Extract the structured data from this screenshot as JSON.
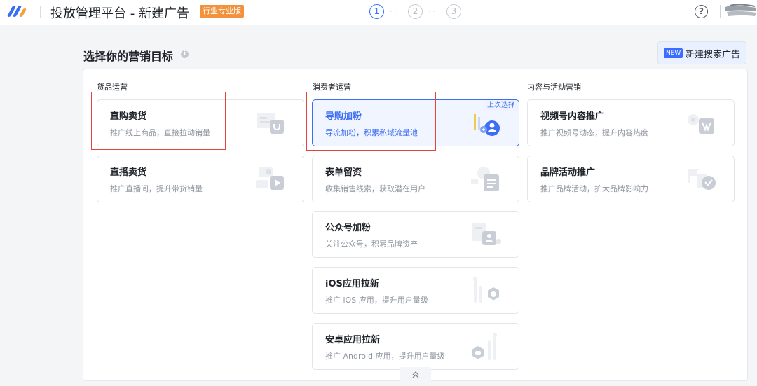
{
  "header": {
    "title": "投放管理平台 - 新建广告",
    "edition_badge": "行业专业版",
    "steps": [
      "1",
      "2",
      "3"
    ],
    "step_separator": "··",
    "help_symbol": "?",
    "logo_colors": [
      "#3b6ef6",
      "#f2a33a"
    ]
  },
  "section": {
    "heading": "选择你的营销目标",
    "info_symbol": "i",
    "search_ad": {
      "badge": "NEW",
      "label": "新建搜索广告"
    }
  },
  "columns": [
    {
      "title": "货品运营",
      "cards": [
        {
          "title": "直购卖货",
          "desc": "推广线上商品，直接拉动销量",
          "icon": "shopping-bag-icon"
        },
        {
          "title": "直播卖货",
          "desc": "推广直播间，提升带货销量",
          "icon": "live-play-icon"
        }
      ]
    },
    {
      "title": "消费者运营",
      "cards": [
        {
          "title": "导购加粉",
          "desc": "导流加粉，积累私域流量池",
          "icon": "add-fans-icon",
          "selected": true,
          "badge": "上次选择"
        },
        {
          "title": "表单留资",
          "desc": "收集销售线索，获取潜在用户",
          "icon": "form-icon"
        },
        {
          "title": "公众号加粉",
          "desc": "关注公众号，积累品牌资产",
          "icon": "official-account-icon"
        },
        {
          "title": "iOS应用拉新",
          "desc": "推广 iOS 应用，提升用户量级",
          "icon": "ios-app-icon"
        },
        {
          "title": "安卓应用拉新",
          "desc": "推广 Android 应用，提升用户量级",
          "icon": "android-app-icon"
        }
      ]
    },
    {
      "title": "内容与活动营销",
      "cards": [
        {
          "title": "视频号内容推广",
          "desc": "推广视频号动态，提升内容热度",
          "icon": "video-channel-icon"
        },
        {
          "title": "品牌活动推广",
          "desc": "推广品牌活动，扩大品牌影响力",
          "icon": "brand-activity-icon"
        }
      ]
    }
  ],
  "collapse_symbol": "≈",
  "colors": {
    "accent": "#3c6ef5",
    "highlight_box": "#e8423c",
    "edition_badge": "#f3923c"
  }
}
